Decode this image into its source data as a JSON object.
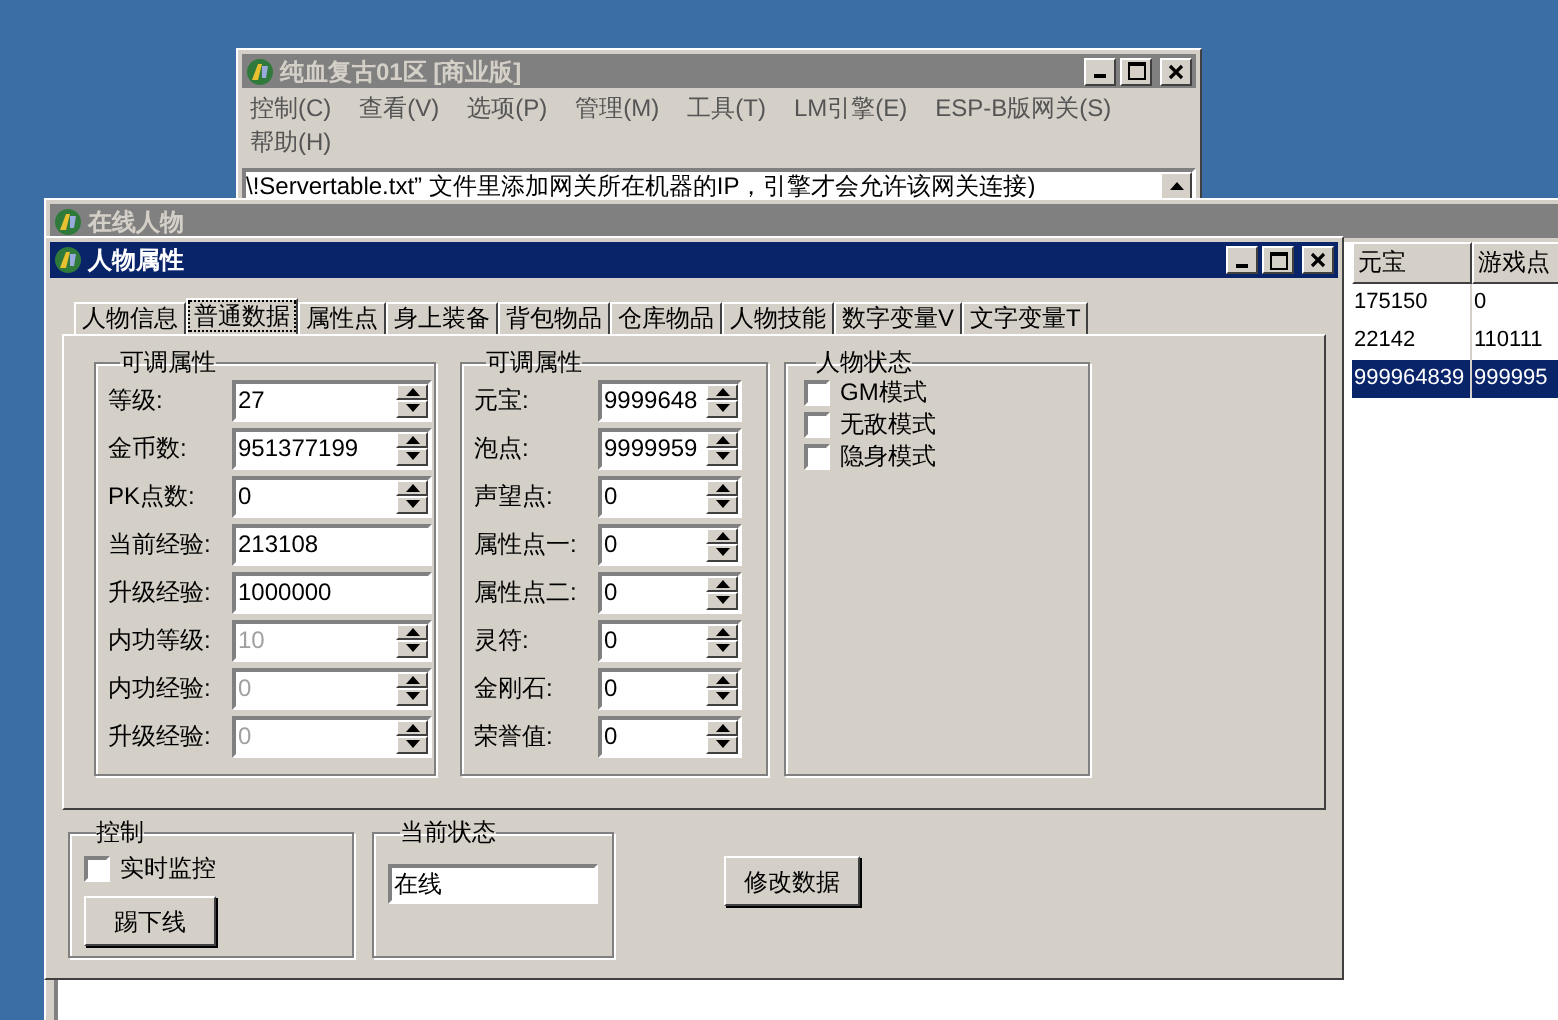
{
  "server_window": {
    "title": "纯血复古01区 [商业版]",
    "menu": [
      "控制(C)",
      "查看(V)",
      "选项(P)",
      "管理(M)",
      "工具(T)",
      "LM引擎(E)",
      "ESP-B版网关(S)",
      "帮助(H)"
    ],
    "log_line": "\\!Servertable.txt” 文件里添加网关所在机器的IP，引擎才会允许该网关连接)"
  },
  "online_window": {
    "title": "在线人物",
    "table": {
      "columns": [
        "元宝",
        "游戏点"
      ],
      "rows": [
        {
          "cells": [
            "175150",
            "0"
          ],
          "selected": false
        },
        {
          "cells": [
            "22142",
            "110111"
          ],
          "selected": false
        },
        {
          "cells": [
            "999964839",
            "999995"
          ],
          "selected": true
        }
      ]
    }
  },
  "attr_window": {
    "title": "人物属性",
    "tabs": [
      {
        "label": "人物信息",
        "selected": false
      },
      {
        "label": "普通数据",
        "selected": true
      },
      {
        "label": "属性点",
        "selected": false
      },
      {
        "label": "身上装备",
        "selected": false
      },
      {
        "label": "背包物品",
        "selected": false
      },
      {
        "label": "仓库物品",
        "selected": false
      },
      {
        "label": "人物技能",
        "selected": false
      },
      {
        "label": "数字变量V",
        "selected": false
      },
      {
        "label": "文字变量T",
        "selected": false
      }
    ],
    "groups": [
      {
        "title": "可调属性",
        "fields": [
          {
            "label": "等级:",
            "value": "27",
            "kind": "spin",
            "disabled": false
          },
          {
            "label": "金币数:",
            "value": "951377199",
            "kind": "spin",
            "disabled": false
          },
          {
            "label": "PK点数:",
            "value": "0",
            "kind": "spin",
            "disabled": false
          },
          {
            "label": "当前经验:",
            "value": "213108",
            "kind": "text",
            "disabled": false
          },
          {
            "label": "升级经验:",
            "value": "1000000",
            "kind": "text",
            "disabled": false
          },
          {
            "label": "内功等级:",
            "value": "10",
            "kind": "spin",
            "disabled": true
          },
          {
            "label": "内功经验:",
            "value": "0",
            "kind": "spin",
            "disabled": true
          },
          {
            "label": "升级经验:",
            "value": "0",
            "kind": "spin",
            "disabled": true
          }
        ]
      },
      {
        "title": "可调属性",
        "fields": [
          {
            "label": "元宝:",
            "value": "9999648",
            "kind": "spin",
            "disabled": false
          },
          {
            "label": "泡点:",
            "value": "9999959",
            "kind": "spin",
            "disabled": false
          },
          {
            "label": "声望点:",
            "value": "0",
            "kind": "spin",
            "disabled": false
          },
          {
            "label": "属性点一:",
            "value": "0",
            "kind": "spin",
            "disabled": false
          },
          {
            "label": "属性点二:",
            "value": "0",
            "kind": "spin",
            "disabled": false
          },
          {
            "label": "灵符:",
            "value": "0",
            "kind": "spin",
            "disabled": false
          },
          {
            "label": "金刚石:",
            "value": "0",
            "kind": "spin",
            "disabled": false
          },
          {
            "label": "荣誉值:",
            "value": "0",
            "kind": "spin",
            "disabled": false
          }
        ]
      }
    ],
    "status_group": {
      "title": "人物状态",
      "checkboxes": [
        {
          "label": "GM模式",
          "checked": false
        },
        {
          "label": "无敌模式",
          "checked": false
        },
        {
          "label": "隐身模式",
          "checked": false
        }
      ]
    },
    "control_group": {
      "title": "控制",
      "checkbox": {
        "label": "实时监控",
        "checked": false
      },
      "button": "踢下线"
    },
    "state_group": {
      "title": "当前状态",
      "value": "在线"
    },
    "submit_button": "修改数据"
  }
}
